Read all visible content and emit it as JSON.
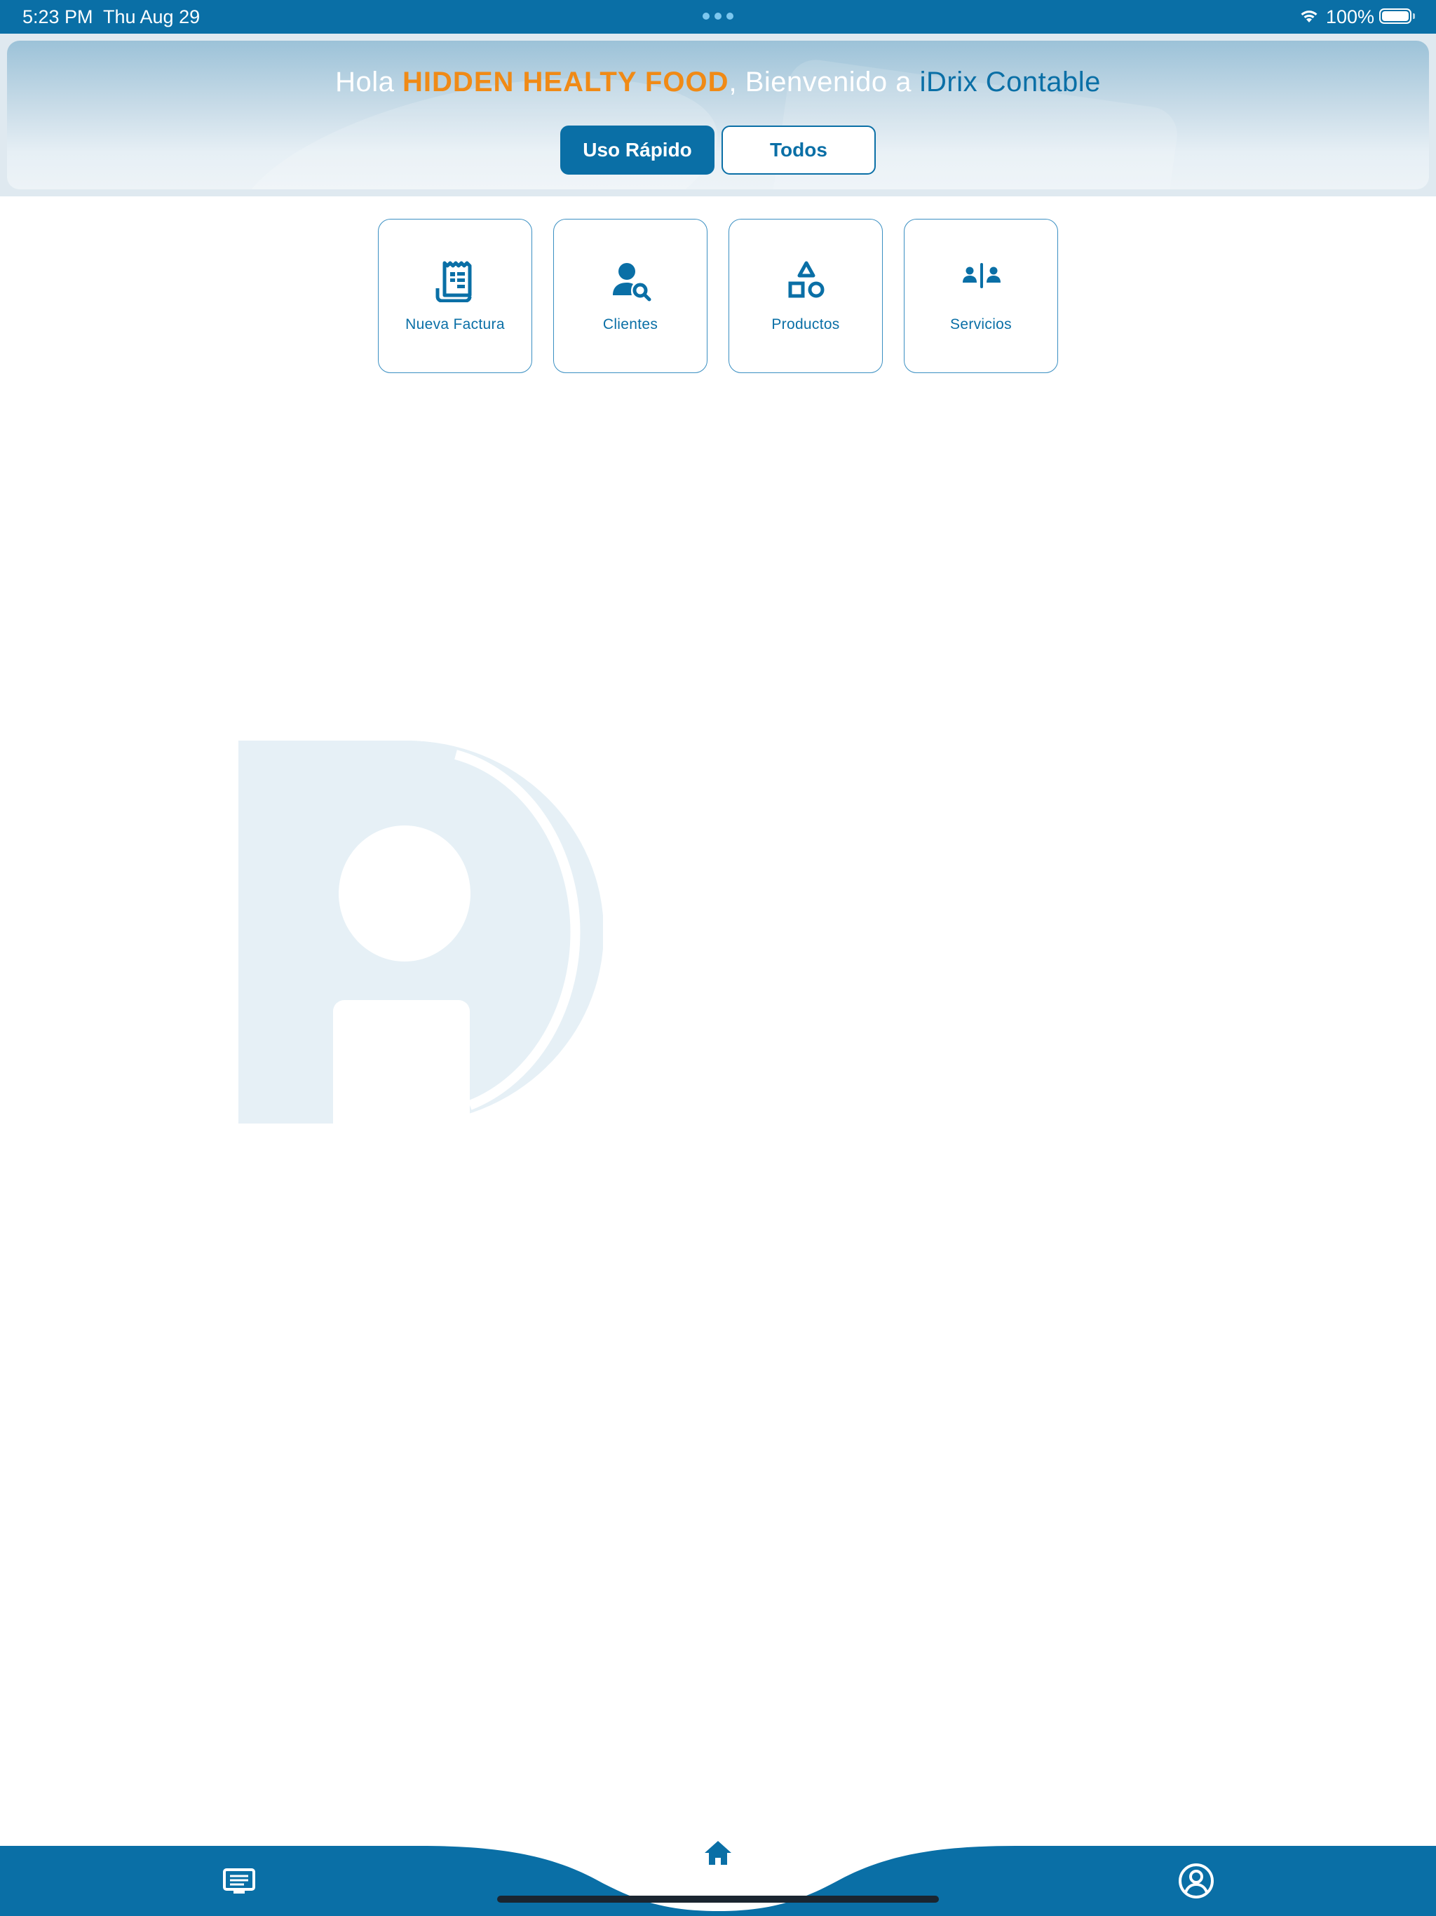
{
  "status_bar": {
    "time": "5:23 PM",
    "date": "Thu Aug 29",
    "battery": "100%",
    "icons": [
      "multitasking-dots-icon",
      "wifi-icon",
      "battery-icon"
    ]
  },
  "header": {
    "greeting_prefix": "Hola ",
    "company_name": "HIDDEN HEALTY FOOD",
    "greeting_middle": ", Bienvenido a ",
    "app_name": "iDrix Contable",
    "segments": [
      {
        "label": "Uso Rápido",
        "selected": true
      },
      {
        "label": "Todos",
        "selected": false
      }
    ]
  },
  "quick_actions": [
    {
      "label": "Nueva Factura",
      "icon": "receipt-icon"
    },
    {
      "label": "Clientes",
      "icon": "user-search-icon"
    },
    {
      "label": "Productos",
      "icon": "shapes-icon"
    },
    {
      "label": "Servicios",
      "icon": "people-split-icon"
    }
  ],
  "tab_bar": {
    "tabs": [
      {
        "icon": "desktop-list-icon"
      },
      {
        "icon": "home-icon",
        "selected": true
      },
      {
        "icon": "profile-icon"
      }
    ]
  },
  "colors": {
    "primary": "#0a6fa6",
    "accent": "#f08a16",
    "watermark": "#e6f0f6"
  }
}
